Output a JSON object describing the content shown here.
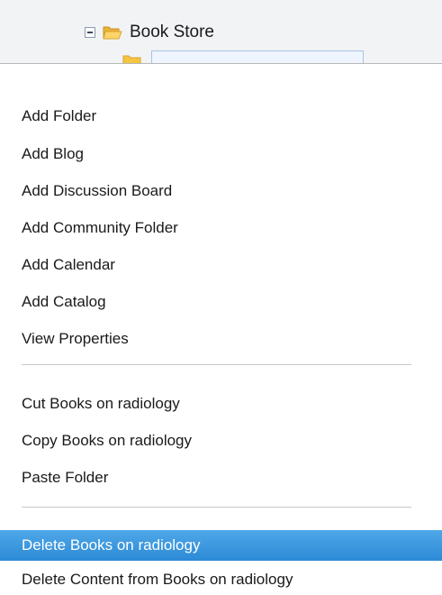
{
  "tree": {
    "node_label": "Book Store",
    "expander_icon": "minus-square-icon",
    "folder_icon": "open-folder-icon",
    "child_folder_icon": "folder-icon"
  },
  "menu": {
    "group1": [
      "Add Folder",
      "Add Blog",
      "Add Discussion Board",
      "Add Community Folder",
      "Add Calendar",
      "Add Catalog",
      "View Properties"
    ],
    "group2": [
      "Cut Books on radiology",
      "Copy Books on radiology",
      "Paste Folder"
    ],
    "group3": [
      "Delete Books on radiology",
      "Delete Content from Books on radiology"
    ],
    "highlighted_item": "Delete Books on radiology"
  },
  "colors": {
    "highlight": "#2d8ad6",
    "highlight_text": "#ffffff",
    "folder": "#f5c542"
  }
}
